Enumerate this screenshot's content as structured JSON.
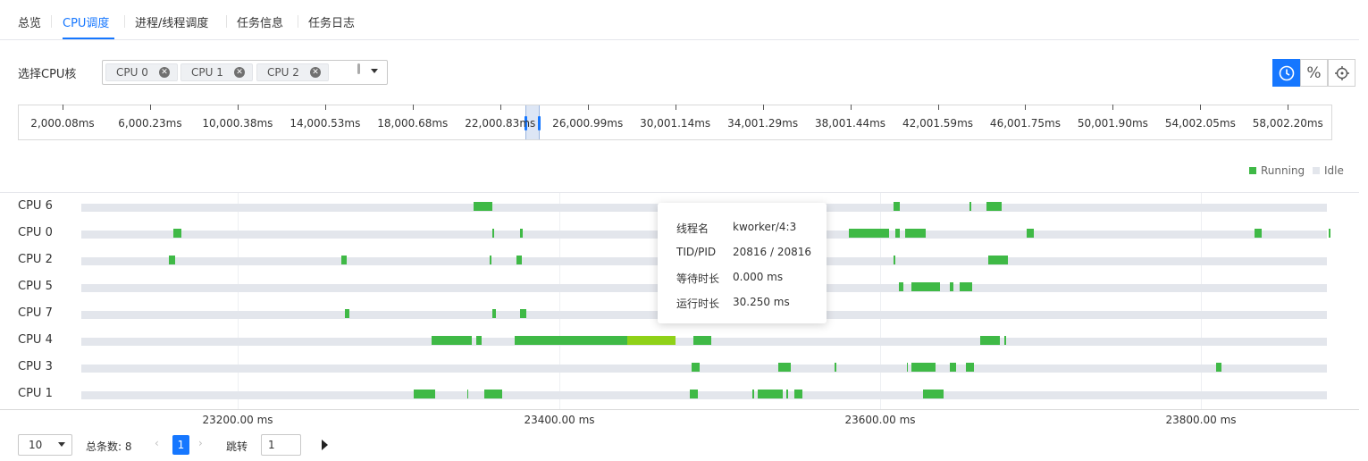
{
  "tabs": [
    {
      "label": "总览",
      "active": false
    },
    {
      "label": "CPU调度",
      "active": true
    },
    {
      "label": "进程/线程调度",
      "active": false
    },
    {
      "label": "任务信息",
      "active": false
    },
    {
      "label": "任务日志",
      "active": false
    }
  ],
  "cpu_select": {
    "label": "选择CPU核",
    "chips": [
      "CPU 0",
      "CPU 1",
      "CPU 2"
    ]
  },
  "toolbar": {
    "icons": [
      "clock-icon",
      "percent-icon",
      "crosshair-icon"
    ],
    "active": "clock-icon",
    "percent_glyph": "%"
  },
  "overview": {
    "ticks": [
      "2,000.08ms",
      "6,000.23ms",
      "10,000.38ms",
      "14,000.53ms",
      "18,000.68ms",
      "22,000.83ms",
      "26,000.99ms",
      "30,001.14ms",
      "34,001.29ms",
      "38,001.44ms",
      "42,001.59ms",
      "46,001.75ms",
      "50,001.90ms",
      "54,002.05ms",
      "58,002.20ms"
    ]
  },
  "legend": {
    "running": "Running",
    "idle": "Idle",
    "running_color": "#3fb946",
    "idle_color": "#e3e6ec",
    "selected_color": "#8fd118"
  },
  "timeline": {
    "x_labels": [
      "23200.00 ms",
      "23400.00 ms",
      "23600.00 ms",
      "23800.00 ms"
    ],
    "rows": [
      {
        "cpu": "CPU 6",
        "segments": [
          [
            23347,
            23359
          ],
          [
            23609,
            23613
          ],
          [
            23656,
            23657
          ],
          [
            23667,
            23676
          ]
        ]
      },
      {
        "cpu": "CPU 0",
        "segments": [
          [
            23160,
            23165
          ],
          [
            23359,
            23360
          ],
          [
            23376,
            23378
          ],
          [
            23581,
            23606
          ],
          [
            23610,
            23613
          ],
          [
            23616,
            23629
          ],
          [
            23692,
            23696
          ],
          [
            23834,
            23838
          ],
          [
            23880,
            23881
          ]
        ]
      },
      {
        "cpu": "CPU 2",
        "segments": [
          [
            23157,
            23161
          ],
          [
            23265,
            23268
          ],
          [
            23357,
            23358
          ],
          [
            23374,
            23377
          ],
          [
            23541,
            23542
          ],
          [
            23609,
            23610
          ],
          [
            23668,
            23680
          ]
        ]
      },
      {
        "cpu": "CPU 5",
        "segments": [
          [
            23535,
            23551
          ],
          [
            23612,
            23615
          ],
          [
            23620,
            23638
          ],
          [
            23644,
            23646
          ],
          [
            23650,
            23658
          ]
        ]
      },
      {
        "cpu": "CPU 7",
        "segments": [
          [
            23267,
            23270
          ],
          [
            23359,
            23361
          ],
          [
            23376,
            23380
          ],
          [
            23468,
            23481
          ],
          [
            23538,
            23551
          ]
        ]
      },
      {
        "cpu": "CPU 4",
        "segments": [
          [
            23321,
            23346
          ],
          [
            23349,
            23352
          ],
          [
            23373,
            23443
          ],
          [
            23484,
            23495
          ],
          [
            23663,
            23675
          ],
          [
            23678,
            23679
          ]
        ]
      },
      {
        "cpu": "CPU 3",
        "segments": [
          [
            23483,
            23488
          ],
          [
            23537,
            23545
          ],
          [
            23572,
            23573
          ],
          [
            23617,
            23618
          ],
          [
            23620,
            23635
          ],
          [
            23644,
            23648
          ],
          [
            23654,
            23659
          ],
          [
            23810,
            23813
          ]
        ]
      },
      {
        "cpu": "CPU 1",
        "segments": [
          [
            23310,
            23323
          ],
          [
            23343,
            23344
          ],
          [
            23354,
            23365
          ],
          [
            23482,
            23487
          ],
          [
            23521,
            23522
          ],
          [
            23524,
            23540
          ],
          [
            23542,
            23543
          ],
          [
            23547,
            23552
          ],
          [
            23627,
            23640
          ]
        ]
      }
    ],
    "selected_segment": {
      "cpu": "CPU 4",
      "start": 23443,
      "end": 23473
    }
  },
  "tooltip": {
    "items": [
      {
        "key": "线程名",
        "value": "kworker/4:3"
      },
      {
        "key": "TID/PID",
        "value": "20816 / 20816"
      },
      {
        "key": "等待时长",
        "value": "0.000 ms"
      },
      {
        "key": "运行时长",
        "value": "30.250 ms"
      }
    ]
  },
  "pagination": {
    "page_size": "10",
    "total_label": "总条数: 8",
    "current_page": "1",
    "jump_label": "跳转",
    "jump_value": "1"
  }
}
